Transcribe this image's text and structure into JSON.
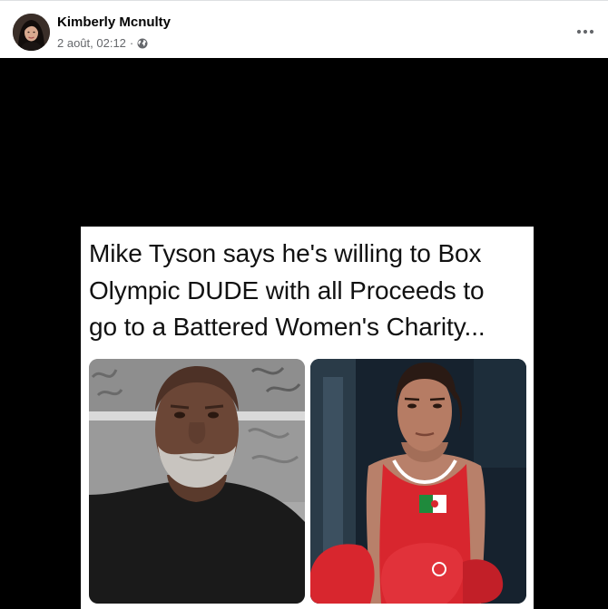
{
  "post": {
    "author": {
      "name": "Kimberly Mcnulty"
    },
    "timestamp": "2 août, 02:12",
    "separator": "·",
    "privacy_icon": "globe-icon",
    "more_icon": "more-horizontal-icon"
  },
  "media": {
    "caption_lines": [
      "Mike Tyson says he's willing to Box",
      "Olympic DUDE with all Proceeds to",
      "go to a Battered Women's Charity..."
    ],
    "photos": [
      {
        "subject": "man-portrait-photo"
      },
      {
        "subject": "boxer-photo"
      }
    ]
  },
  "colors": {
    "name_text": "#050505",
    "meta_text": "#65676b",
    "media_background": "#000000",
    "boxing_red": "#d8262e"
  }
}
